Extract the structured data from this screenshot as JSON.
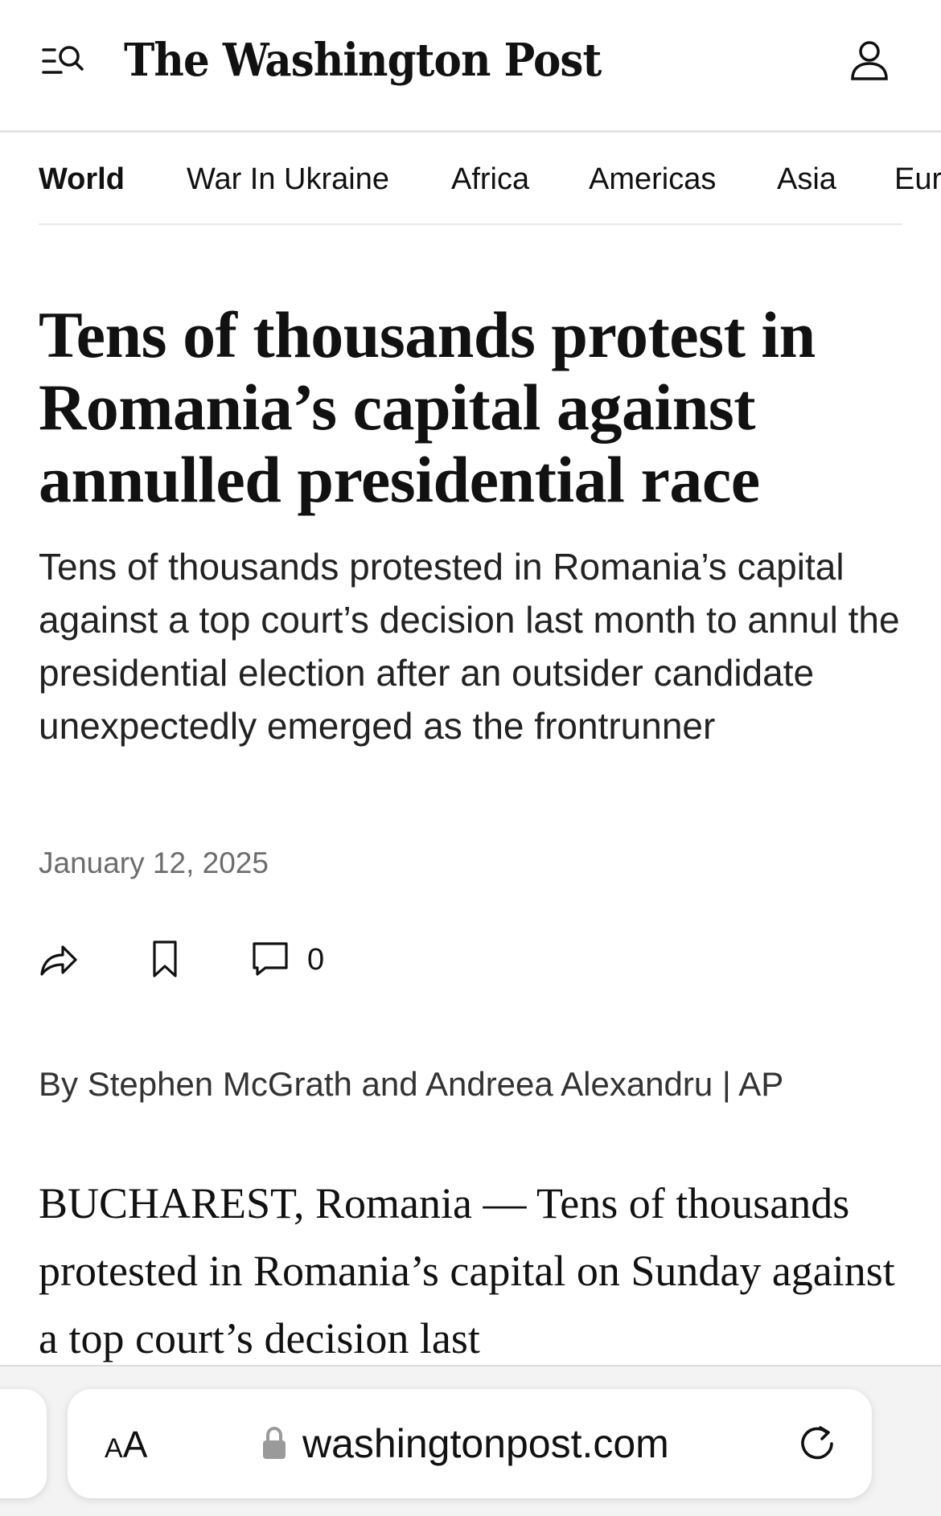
{
  "header": {
    "masthead": "The Washington Post",
    "menu_icon": "menu-search-icon",
    "account_icon": "user-icon"
  },
  "sections": {
    "items": [
      "World",
      "War In Ukraine",
      "Africa",
      "Americas",
      "Asia",
      "Europe"
    ],
    "active": "World"
  },
  "article": {
    "headline": "Tens of thousands protest in Romania’s capital against annulled presidential race",
    "dek": "Tens of thousands protested in Romania’s capital against a top court’s decision last month to annul the presidential election after an outsider candidate unexpectedly emerged as the frontrunner",
    "date": "January 12, 2025",
    "comment_count": "0",
    "byline": {
      "prefix": "By ",
      "author1": "Stephen McGrath",
      "and": " and ",
      "author2": "Andreea Alexandru",
      "sep": " | ",
      "agency": "AP"
    },
    "body_start": "BUCHAREST, Romania — Tens of thousands protested in Romania’s capital on Sunday against a top court’s decision last"
  },
  "actions": {
    "share_icon": "share-icon",
    "bookmark_icon": "bookmark-icon",
    "comment_icon": "comment-icon"
  },
  "browser": {
    "aa_label_small": "A",
    "aa_label_large": "A",
    "url": "washingtonpost.com",
    "lock_icon": "lock-icon",
    "reload_icon": "reload-icon"
  }
}
